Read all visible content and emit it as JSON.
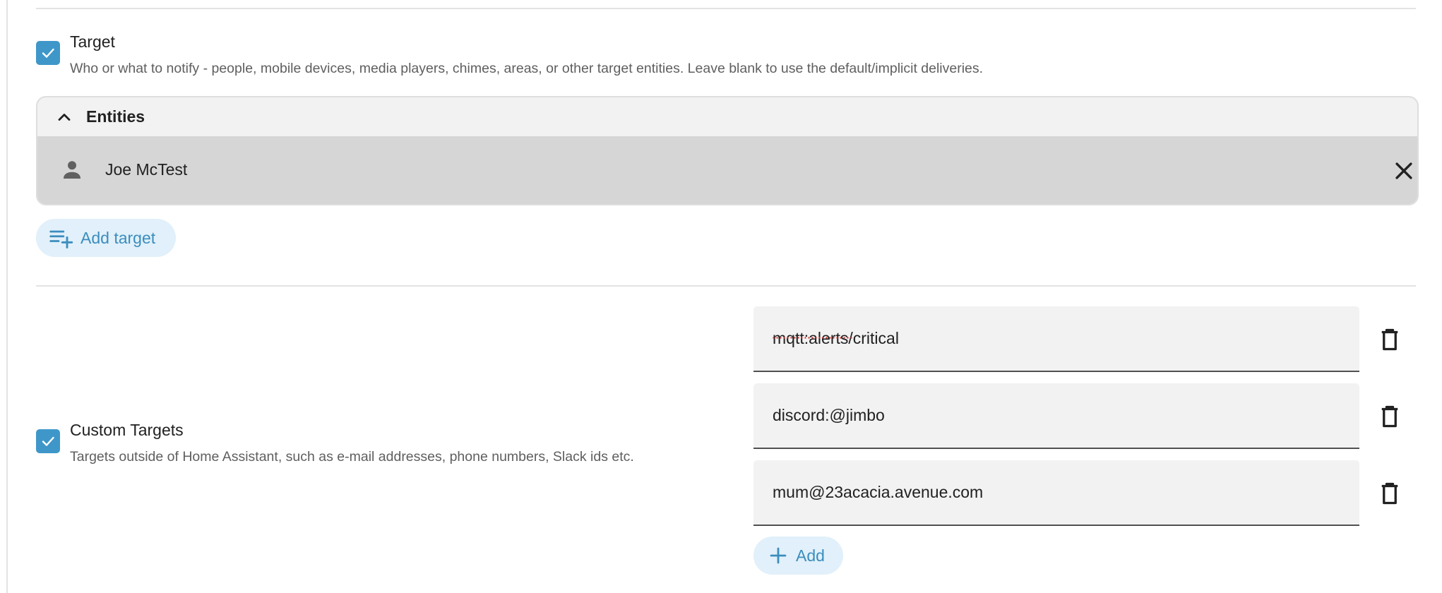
{
  "target_section": {
    "checked": true,
    "title": "Target",
    "description": "Who or what to notify - people, mobile devices, media players, chimes, areas, or other target entities. Leave blank to use the default/implicit deliveries."
  },
  "entities_panel": {
    "title": "Entities",
    "expanded": true,
    "items": [
      {
        "label": "Joe McTest",
        "icon": "person-icon"
      }
    ]
  },
  "add_target_button": {
    "label": "Add target",
    "icon": "playlist-plus-icon"
  },
  "custom_targets_section": {
    "checked": true,
    "title": "Custom Targets",
    "description": "Targets outside of Home Assistant, such as e-mail addresses, phone numbers, Slack ids etc.",
    "fields": [
      {
        "value": "mqtt:alerts/critical"
      },
      {
        "value": "discord:@jimbo"
      },
      {
        "value": "mum@23acacia.avenue.com"
      }
    ],
    "add_button": {
      "label": "Add",
      "icon": "plus-icon"
    }
  },
  "colors": {
    "accent": "#3f97c9",
    "accent_text": "#3b8dbd",
    "pill_bg": "#e1f0fa",
    "panel_bg": "#f2f2f2",
    "entity_row_bg": "#d6d6d6",
    "field_bg": "#f2f2f2",
    "divider": "#e3e3e3"
  }
}
